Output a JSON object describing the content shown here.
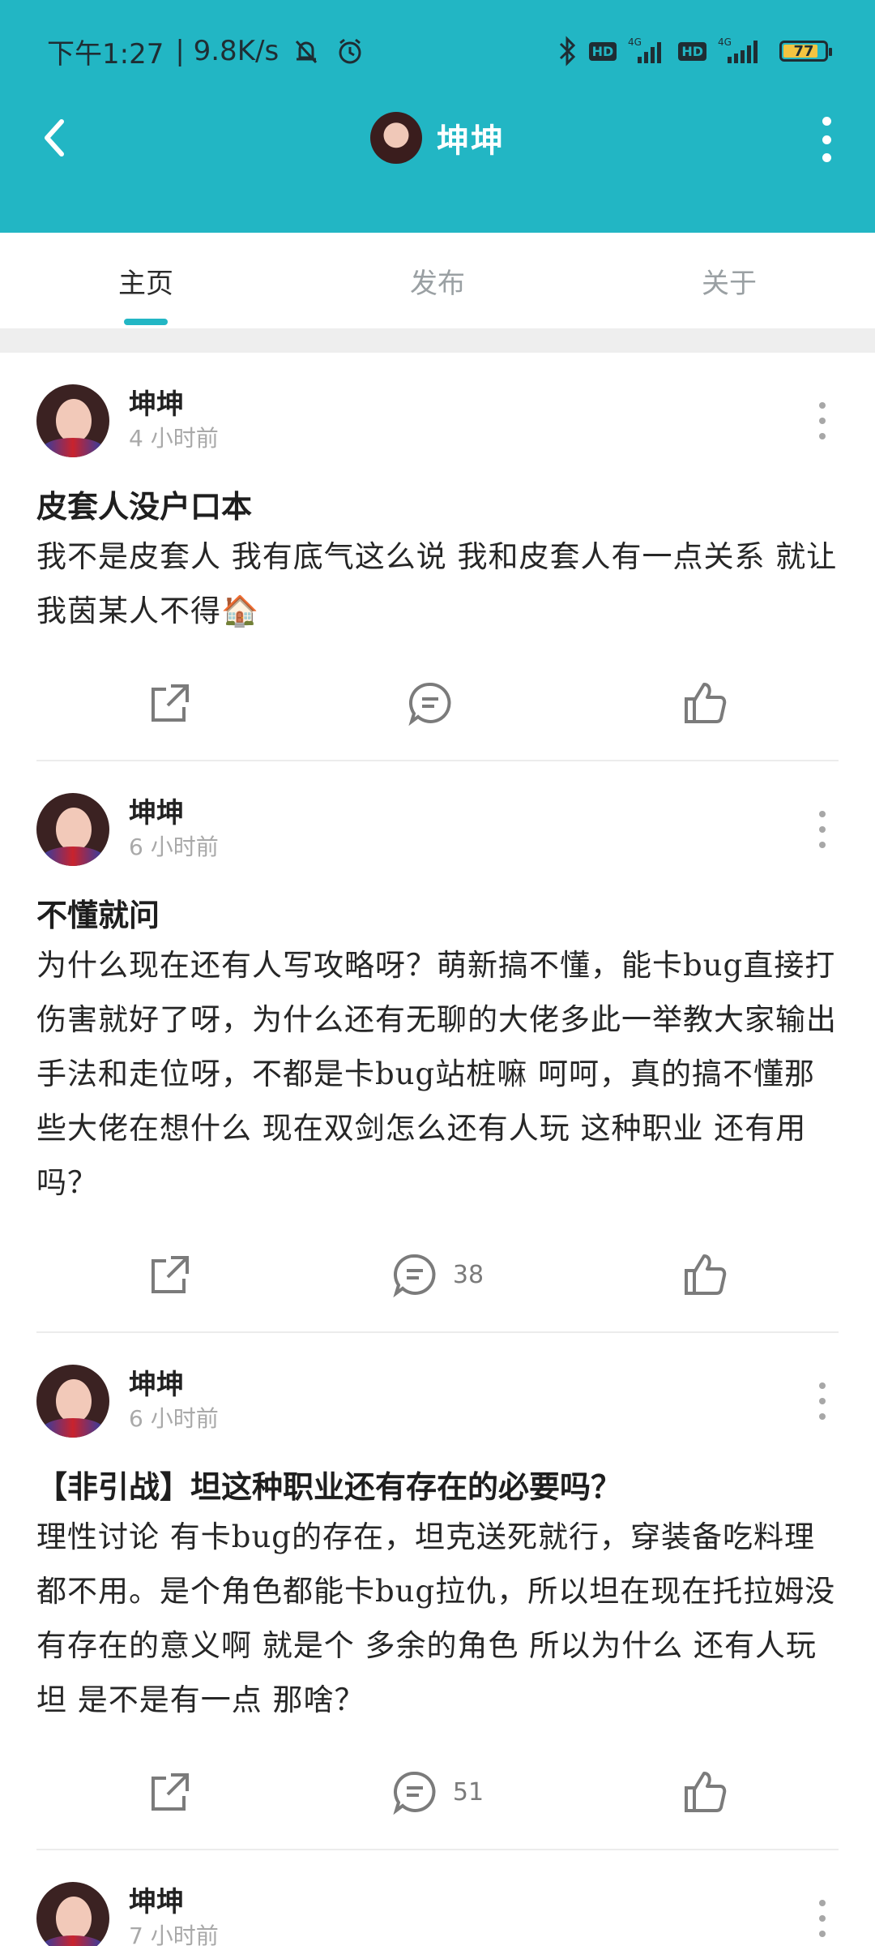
{
  "status": {
    "time": "下午1:27",
    "net_speed": "| 9.8K/s",
    "battery": "77",
    "net_type_1": "4G",
    "net_type_2": "4G",
    "hd_label": "HD"
  },
  "header": {
    "title": "坤坤"
  },
  "tabs": [
    {
      "label": "主页",
      "active": true
    },
    {
      "label": "发布",
      "active": false
    },
    {
      "label": "关于",
      "active": false
    }
  ],
  "posts": [
    {
      "author": "坤坤",
      "time": "4 小时前",
      "title": "皮套人没户口本",
      "body": "我不是皮套人 我有底气这么说 我和皮套人有一点关系 就让我茵某人不得🏠",
      "comments": ""
    },
    {
      "author": "坤坤",
      "time": "6 小时前",
      "title": "不懂就问",
      "body": "为什么现在还有人写攻略呀？萌新搞不懂，能卡bug直接打伤害就好了呀，为什么还有无聊的大佬多此一举教大家输出手法和走位呀，不都是卡bug站桩嘛 呵呵，真的搞不懂那些大佬在想什么 现在双剑怎么还有人玩 这种职业 还有用吗？",
      "comments": "38"
    },
    {
      "author": "坤坤",
      "time": "6 小时前",
      "title": "【非引战】坦这种职业还有存在的必要吗？",
      "body": "理性讨论 有卡bug的存在，坦克送死就行，穿装备吃料理都不用。是个角色都能卡bug拉仇，所以坦在现在托拉姆没有存在的意义啊 就是个 多余的角色 所以为什么 还有人玩坦 是不是有一点 那啥？",
      "comments": "51"
    },
    {
      "author": "坤坤",
      "time": "7 小时前",
      "title": "",
      "body": "",
      "comments": ""
    }
  ],
  "colors": {
    "accent": "#22b6c4",
    "text": "#222222",
    "muted": "#a9a9a9"
  },
  "icons": {
    "back": "chevron-left-icon",
    "more": "more-vertical-icon",
    "share": "share-icon",
    "comment": "comment-icon",
    "like": "thumbs-up-icon"
  }
}
